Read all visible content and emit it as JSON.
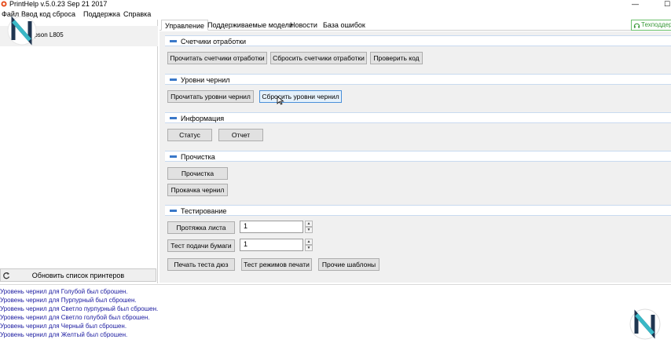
{
  "window": {
    "title": "PrintHelp v.5.0.23 Sep 21 2017",
    "minimize": "—",
    "maximize": "☐"
  },
  "menu": {
    "items": [
      "Файл",
      "Ввод код сброса",
      "Поддержка",
      "Справка"
    ]
  },
  "printers": {
    "selected": "Epson L805",
    "refresh_label": "Обновить список принтеров"
  },
  "tabs": [
    "Управление",
    "Поддерживаемые модели",
    "Новости",
    "База ошибок"
  ],
  "support_label": "Техподдержка",
  "sections": {
    "counters": {
      "title": "Счетчики отработки",
      "read": "Прочитать счетчики отработки",
      "reset": "Сбросить счетчики отработки",
      "check": "Проверить код"
    },
    "ink": {
      "title": "Уровни чернил",
      "read": "Прочитать уровни чернил",
      "reset": "Сбросить уровни чернил"
    },
    "info": {
      "title": "Информация",
      "status": "Статус",
      "report": "Отчет"
    },
    "cleaning": {
      "title": "Прочистка",
      "clean": "Прочистка",
      "pump": "Прокачка чернил"
    },
    "testing": {
      "title": "Тестирование",
      "feed_sheet": "Протяжка листа",
      "feed_sheet_value": "1",
      "paper_test": "Тест подачи бумаги",
      "paper_test_value": "1",
      "nozzle": "Печать теста дюз",
      "print_modes": "Тест режимов печати",
      "other": "Прочие шаблоны"
    }
  },
  "log": [
    "Уровень чернил для Голубой был сброшен.",
    "Уровень чернил для Пурпурный был сброшен.",
    "Уровень чернил для Светло пурпурный был сброшен.",
    "Уровень чернил для Светло голубой был сброшен.",
    "Уровень чернил для Черный был сброшен.",
    "Уровень чернил для Желтый был сброшен."
  ],
  "colors": {
    "accent": "#3a78c9",
    "log_text": "#1a1aa0",
    "support_green": "#3a9a3a"
  }
}
